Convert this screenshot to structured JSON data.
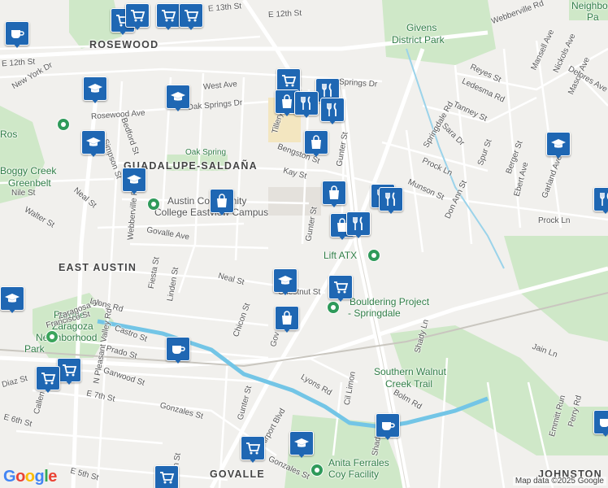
{
  "areas": {
    "rosewood": "ROSEWOOD",
    "guadalupe_saldana": "GUADALUPE-SALDAÑA",
    "east_austin": "EAST AUSTIN",
    "govalle": "GOVALLE",
    "johnston": "JOHNSTON",
    "neighbo": "Neighbo",
    "pa": "Pa"
  },
  "parks": {
    "givens_line1": "Givens",
    "givens_line2": "District Park",
    "boggy_line1": "Boggy Creek",
    "boggy_line2": "Greenbelt",
    "rosewood_park": "Rosewood Park",
    "oak_spring": "Oak Spring",
    "parque_1": "Parque",
    "parque_2": "Zaragoza",
    "parque_3": "Neighborhood",
    "parque_4": "Park",
    "southern_walnut_1": "Southern Walnut",
    "southern_walnut_2": "Creek Trail"
  },
  "places": {
    "acc_line1": "Austin Community",
    "acc_line2": "College Eastview Campus",
    "lift_atx": "Lift ATX",
    "bouldering_1": "Bouldering Project",
    "bouldering_2": "- Springdale",
    "anita_1": "Anita Ferrales",
    "anita_2": "Coy Facility"
  },
  "streets": [
    "E 13th St",
    "E 12th St",
    "E 12th St",
    "New York Dr",
    "Webberville Rd",
    "Mansell Ave",
    "Nickols Ave",
    "Mason Ave",
    "Delores Ave",
    "Reyes St",
    "Ledesma Rd",
    "Tanney St",
    "Springdale Rd",
    "Sara Dr",
    "Rosewood Ave",
    "Oak Springs Dr",
    "Springs Dr",
    "Bengston St",
    "Gunter St",
    "Kay St",
    "Tillery St",
    "Prock Ln",
    "Munson St",
    "Don Ann St",
    "Spur St",
    "Berger St",
    "Ebert Ave",
    "Garland Ave",
    "Prock Ln",
    "Nile St",
    "Neal St",
    "Walter St",
    "Bedford St",
    "Simpson St",
    "Webberville Rd",
    "Govalle Ave",
    "Gunter St",
    "Fiesta St",
    "Linden St",
    "Neal St",
    "Chestnut St",
    "Chicon St",
    "Zaragosa St",
    "Francisco St",
    "Lyons Rd",
    "N Pleasant Valley Rd",
    "Castro St",
    "Prado St",
    "Garwood St",
    "E 7th St",
    "Gonzales St",
    "Gunter St",
    "Airport Blvd",
    "Lyons Rd",
    "Cil Limon",
    "Shady Ln",
    "Jain Ln",
    "Bolm Rd",
    "Emmitt Run",
    "Perry Rd",
    "E 5th St",
    "Gonzales St",
    "Callen St",
    "Diaz St",
    "E 6th St",
    "Glen St",
    "Shady Ln",
    "Gov St",
    "West Ave"
  ],
  "google_logo": "Google",
  "map_credit": "Map data ©2025 Google",
  "colors": {
    "pin": "#1f67b3",
    "park_green": "#cfe8c8",
    "water": "#aadaff",
    "creek": "#73c5e6",
    "highway": "#ffffff",
    "school_area": "#f3e6c0"
  },
  "icon_types": [
    "grocery-cart-icon",
    "coffee-cup-icon",
    "school-cap-icon",
    "shopping-bag-icon",
    "restaurant-icon"
  ]
}
